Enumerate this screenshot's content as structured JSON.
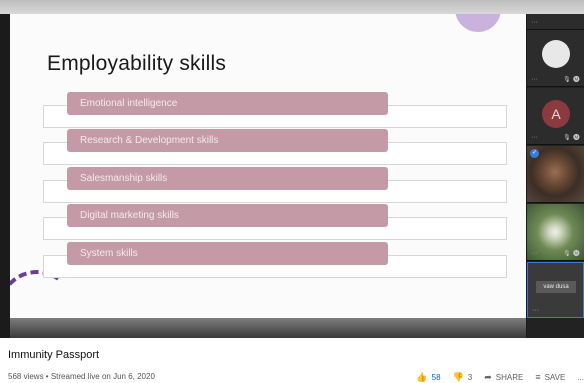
{
  "slide": {
    "title": "Employability skills",
    "skills": [
      "Emotional intelligence",
      "Research & Development skills",
      "Salesmanship skills",
      "Digital marketing skills",
      "System skills"
    ]
  },
  "participants": {
    "avatar_letter": "A",
    "name_label": "vaw dusa",
    "dots": "···",
    "mic": "🎙 Ⓜ"
  },
  "video": {
    "title": "Immunity Passport",
    "meta": "568 views • Streamed live on Jun 6, 2020",
    "likes": "58",
    "dislikes": "3",
    "share_label": "SHARE",
    "save_label": "SAVE",
    "more_label": "..."
  },
  "colors": {
    "pill": "#c49aa6",
    "accent_circle": "#c9b3de",
    "accent_arc": "#6a3f96",
    "like_blue": "#065fd4"
  },
  "icons": [
    "thumbs-up-icon",
    "thumbs-down-icon",
    "share-icon",
    "save-playlist-icon",
    "more-icon",
    "check-icon"
  ]
}
